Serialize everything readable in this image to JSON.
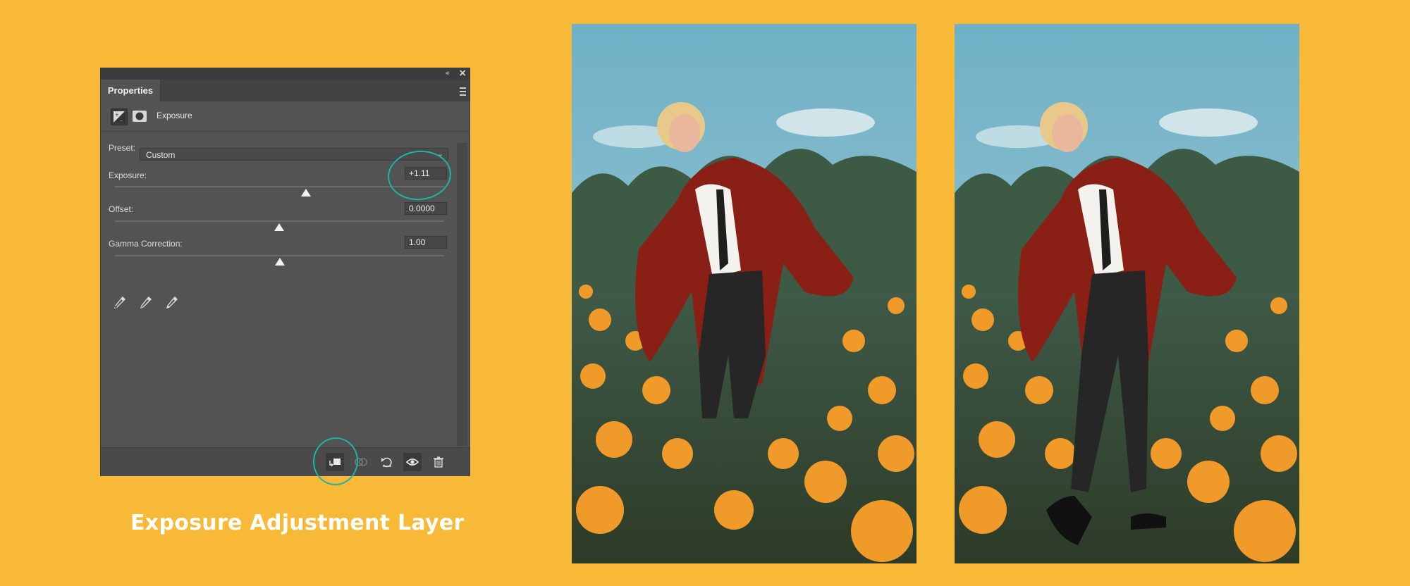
{
  "panel": {
    "tab_label": "Properties",
    "adjustment_title": "Exposure",
    "preset": {
      "label": "Preset:",
      "value": "Custom"
    },
    "sliders": [
      {
        "label": "Exposure:",
        "value": "+1.11",
        "position": 0.5
      },
      {
        "label": "Offset:",
        "value": "0.0000",
        "position": 0.5
      },
      {
        "label": "Gamma Correction:",
        "value": "1.00",
        "position": 0.5
      }
    ],
    "icons": {
      "collapse": "collapse-icon",
      "close": "close-icon",
      "menu": "panel-menu-icon",
      "adjustment": "exposure-adjustment-icon",
      "mask": "layer-mask-icon",
      "eyedroppers": [
        "black-point-eyedropper-icon",
        "gray-point-eyedropper-icon",
        "white-point-eyedropper-icon"
      ],
      "footer": [
        "clip-to-layer-icon",
        "view-previous-state-icon",
        "reset-icon",
        "visibility-eye-icon",
        "delete-icon"
      ]
    }
  },
  "caption": "Exposure Adjustment Layer",
  "colors": {
    "background": "#F9B938",
    "annotation": "#1DB5A2",
    "panel": "#535353"
  },
  "photos": [
    {
      "name": "before-photo",
      "description_visible": ""
    },
    {
      "name": "after-photo",
      "description_visible": ""
    }
  ]
}
